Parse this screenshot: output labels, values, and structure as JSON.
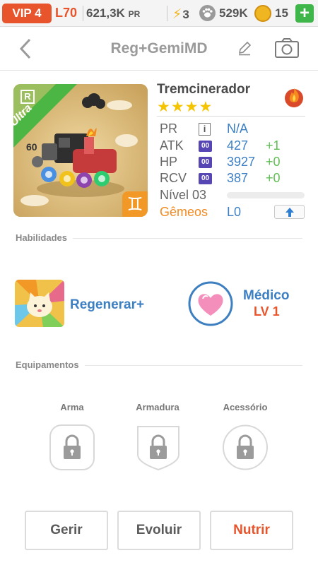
{
  "topbar": {
    "vip": "VIP 4",
    "level": "L70",
    "pr_value": "621,3K",
    "pr_unit": "PR",
    "energy": "3",
    "paw_value": "529K",
    "coins": "15",
    "plus": "+",
    "icons": [
      "bolt-icon",
      "paw-icon",
      "coin-icon",
      "plus-icon"
    ]
  },
  "header": {
    "title": "Reg+GemiMD",
    "icons": [
      "chevron-left-icon",
      "pencil-icon",
      "camera-icon"
    ]
  },
  "monster": {
    "name": "Tremcinerador",
    "stars": "★★★★",
    "star_count": 4,
    "rarity_letter": "R",
    "rarity_ribbon": "Ultra",
    "sign_symbol": "♊",
    "element": "fire",
    "stats": {
      "pr_label": "PR",
      "pr_badge": "i",
      "pr_value": "N/A",
      "atk_label": "ATK",
      "atk_value": "427",
      "atk_bonus": "+1",
      "hp_label": "HP",
      "hp_value": "3927",
      "hp_bonus": "+0",
      "rcv_label": "RCV",
      "rcv_value": "387",
      "rcv_bonus": "+0",
      "stat_badge": "00",
      "level_label": "Nível 03",
      "level_progress": 0,
      "gemeos_label": "Gêmeos",
      "gemeos_value": "L0"
    }
  },
  "sections": {
    "skills_label": "Habilidades",
    "equip_label": "Equipamentos"
  },
  "skill": {
    "name": "Regenerar+"
  },
  "leader": {
    "name": "Médico",
    "level": "LV 1"
  },
  "equipment": {
    "weapon": "Arma",
    "armor": "Armadura",
    "accessory": "Acessório"
  },
  "buttons": {
    "manage": "Gerir",
    "evolve": "Evoluir",
    "feed": "Nutrir"
  },
  "colors": {
    "accent_orange": "#e8542b",
    "stat_blue": "#3c7fc2",
    "bonus_green": "#5fbf52",
    "star_yellow": "#f5c400",
    "badge_purple": "#5546b3"
  }
}
